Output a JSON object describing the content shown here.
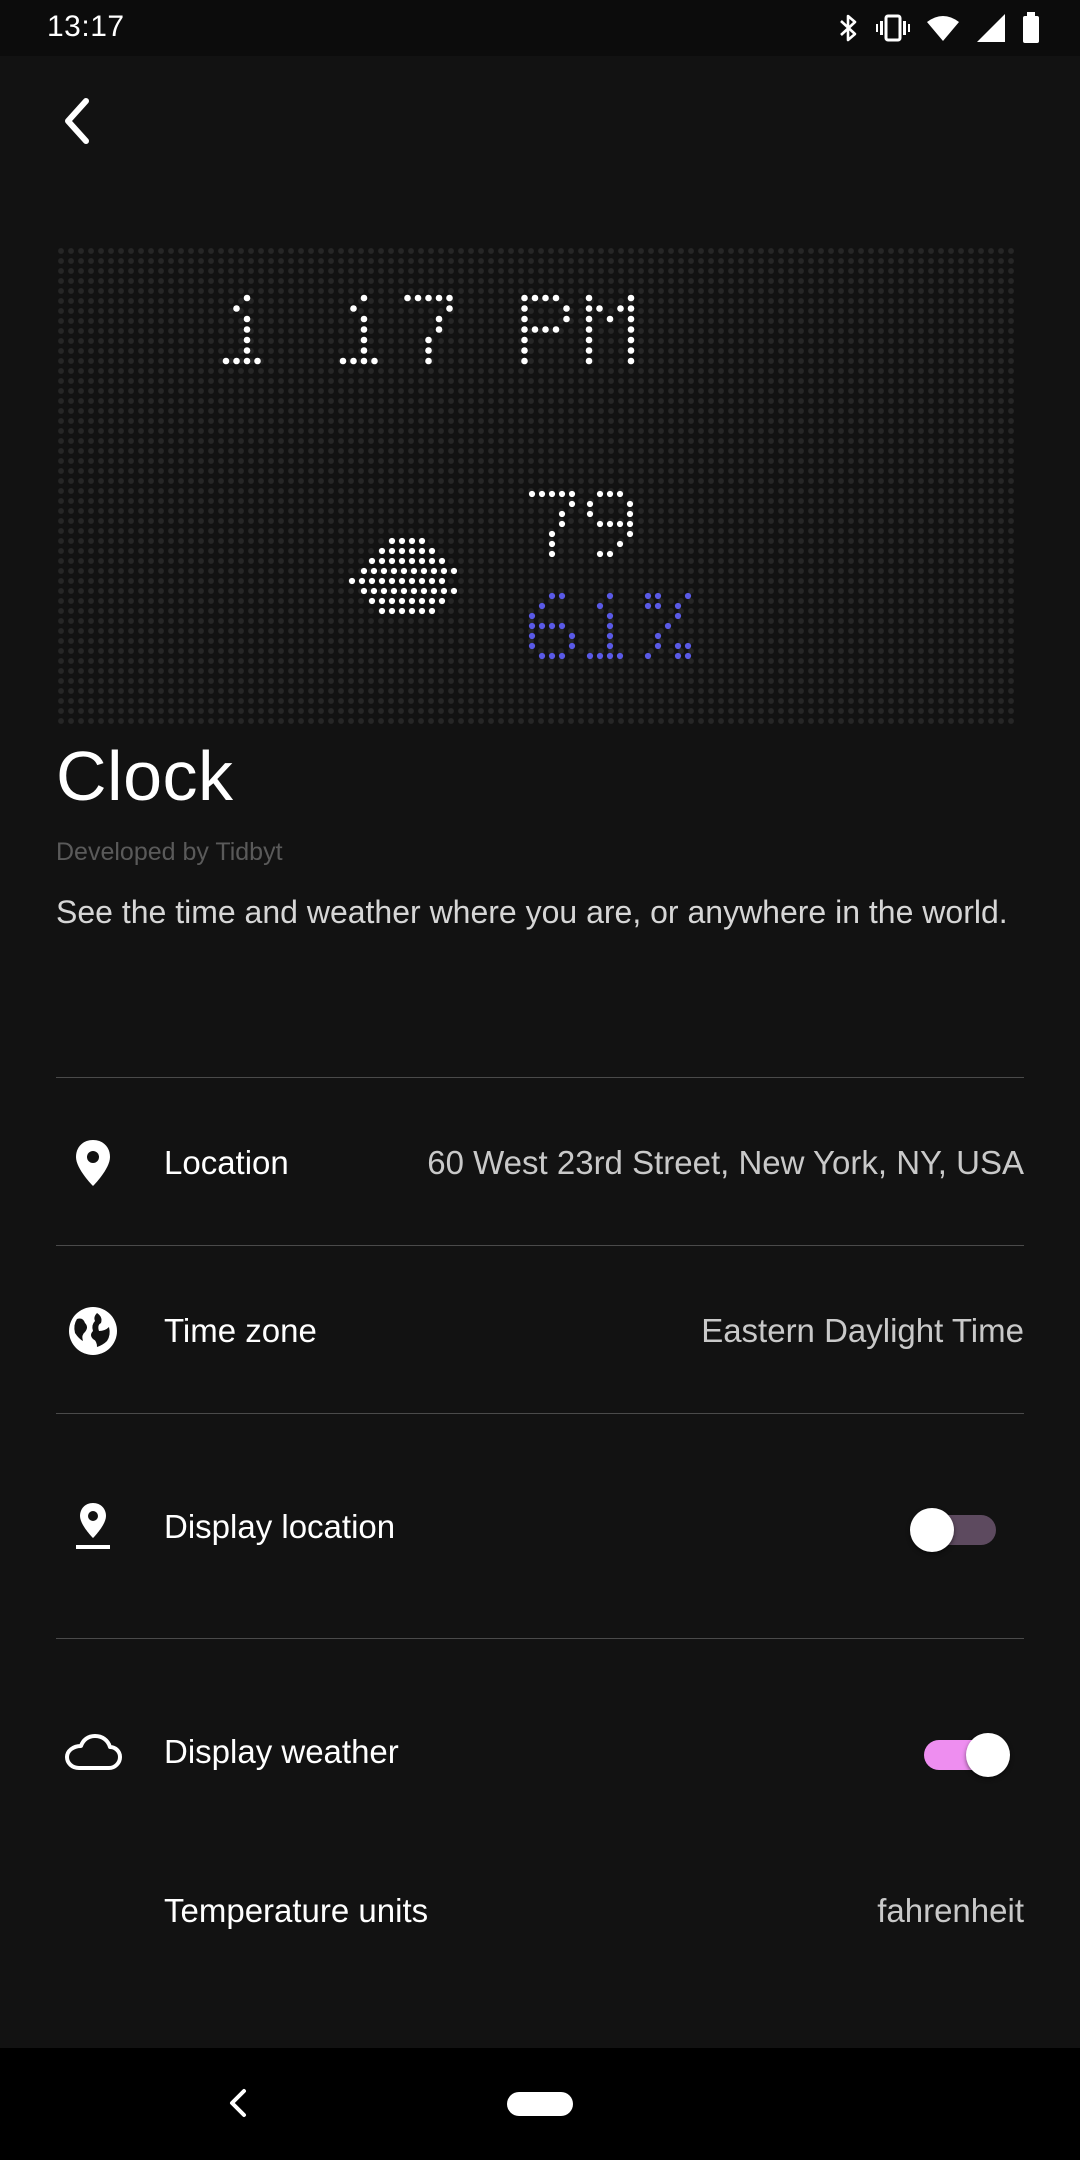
{
  "status_bar": {
    "time": "13:17",
    "icons": [
      "bluetooth-icon",
      "vibrate-icon",
      "wifi-icon",
      "signal-icon",
      "battery-icon"
    ]
  },
  "header": {
    "back_icon": "chevron-left-icon"
  },
  "app": {
    "title": "Clock",
    "developer": "Developed by Tidbyt",
    "description": "See the time and weather where you are, or anywhere in the world."
  },
  "led_preview": {
    "time_text": "1 17 PM",
    "weather_icon": "cloud-icon",
    "temperature": "79",
    "humidity": "61%",
    "colors": {
      "foreground": "#ffffff",
      "humidity": "#5a5ae6",
      "off_dot": "#262626"
    }
  },
  "settings": {
    "location": {
      "icon": "location-pin-icon",
      "label": "Location",
      "value": "60 West 23rd Street, New York, NY, USA"
    },
    "time_zone": {
      "icon": "globe-icon",
      "label": "Time zone",
      "value": "Eastern Daylight Time"
    },
    "display_location": {
      "icon": "pin-on-line-icon",
      "label": "Display location",
      "enabled": false
    },
    "display_weather": {
      "icon": "cloud-outline-icon",
      "label": "Display weather",
      "enabled": true
    },
    "temperature_units": {
      "label": "Temperature units",
      "value": "fahrenheit"
    }
  },
  "colors": {
    "background": "#121212",
    "accent": "#ee8ef0",
    "toggle_off_track": "#5d4a5f",
    "divider": "#4a4a4a"
  },
  "nav_bar": {
    "back_icon": "nav-back-icon",
    "home_icon": "home-pill-icon"
  }
}
